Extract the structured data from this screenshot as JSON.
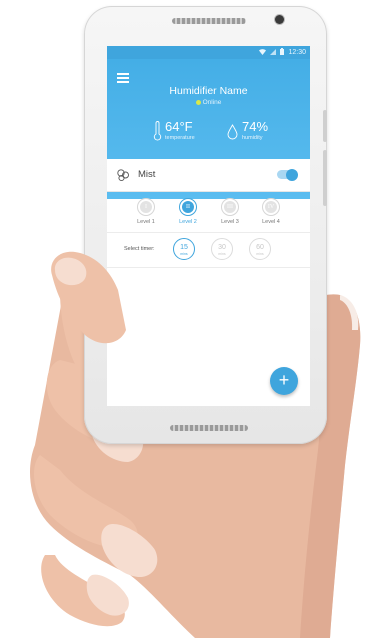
{
  "statusbar": {
    "time": "12:30"
  },
  "header": {
    "device_name": "Humidifier Name",
    "status": "Online",
    "temperature": {
      "value": "64°F",
      "label": "temperature"
    },
    "humidity": {
      "value": "74%",
      "label": "humidity"
    }
  },
  "mist": {
    "label": "Mist",
    "enabled": true
  },
  "levels": [
    {
      "numeral": "I",
      "label": "Level 1",
      "selected": false
    },
    {
      "numeral": "II",
      "label": "Level 2",
      "selected": true
    },
    {
      "numeral": "III",
      "label": "Level 3",
      "selected": false
    },
    {
      "numeral": "IV",
      "label": "Level 4",
      "selected": false
    }
  ],
  "timer": {
    "label": "Select timer:",
    "options": [
      {
        "value": "15",
        "unit": "mins",
        "selected": true
      },
      {
        "value": "30",
        "unit": "mins",
        "selected": false
      },
      {
        "value": "60",
        "unit": "mins",
        "selected": false
      }
    ]
  },
  "fab": {
    "icon": "plus-icon",
    "glyph": "+"
  },
  "colors": {
    "accent": "#3fa5dd",
    "header": "#4db3ea"
  },
  "icons": [
    "menu-icon",
    "wifi-icon",
    "signal-icon",
    "battery-icon",
    "thermometer-icon",
    "droplet-icon",
    "mist-icon",
    "plus-icon"
  ]
}
